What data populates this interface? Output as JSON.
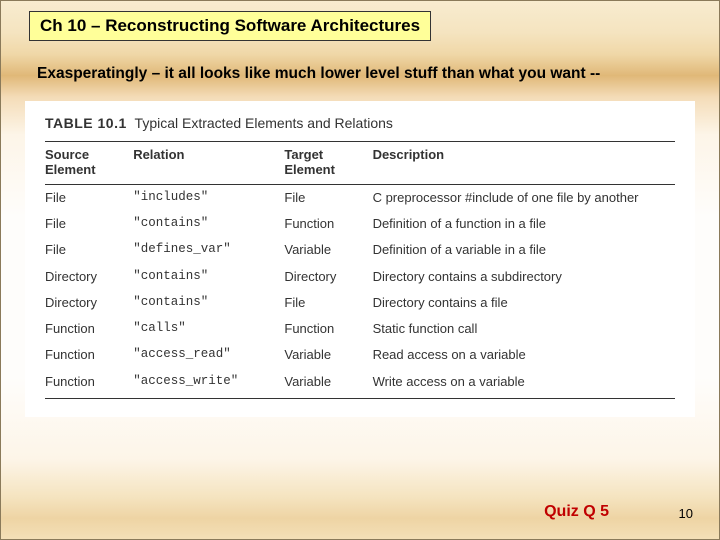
{
  "title": "Ch 10 – Reconstructing Software Architectures",
  "subtitle": "Exasperatingly – it all looks like much lower level stuff than what you want --",
  "table": {
    "label": "TABLE 10.1",
    "caption": "Typical Extracted Elements and Relations",
    "headers": {
      "c1a": "Source",
      "c1b": "Element",
      "c2": "Relation",
      "c3a": "Target",
      "c3b": "Element",
      "c4": "Description"
    },
    "rows": [
      {
        "src": "File",
        "rel": "\"includes\"",
        "tgt": "File",
        "desc": "C preprocessor #include of one file by another"
      },
      {
        "src": "File",
        "rel": "\"contains\"",
        "tgt": "Function",
        "desc": "Definition of a function in a file"
      },
      {
        "src": "File",
        "rel": "\"defines_var\"",
        "tgt": "Variable",
        "desc": "Definition of a variable in a file"
      },
      {
        "src": "Directory",
        "rel": "\"contains\"",
        "tgt": "Directory",
        "desc": "Directory contains a subdirectory"
      },
      {
        "src": "Directory",
        "rel": "\"contains\"",
        "tgt": "File",
        "desc": "Directory contains a file"
      },
      {
        "src": "Function",
        "rel": "\"calls\"",
        "tgt": "Function",
        "desc": "Static function call"
      },
      {
        "src": "Function",
        "rel": "\"access_read\"",
        "tgt": "Variable",
        "desc": "Read access on a variable"
      },
      {
        "src": "Function",
        "rel": "\"access_write\"",
        "tgt": "Variable",
        "desc": "Write access on a variable"
      }
    ]
  },
  "quiz": "Quiz Q 5",
  "page_number": "10"
}
